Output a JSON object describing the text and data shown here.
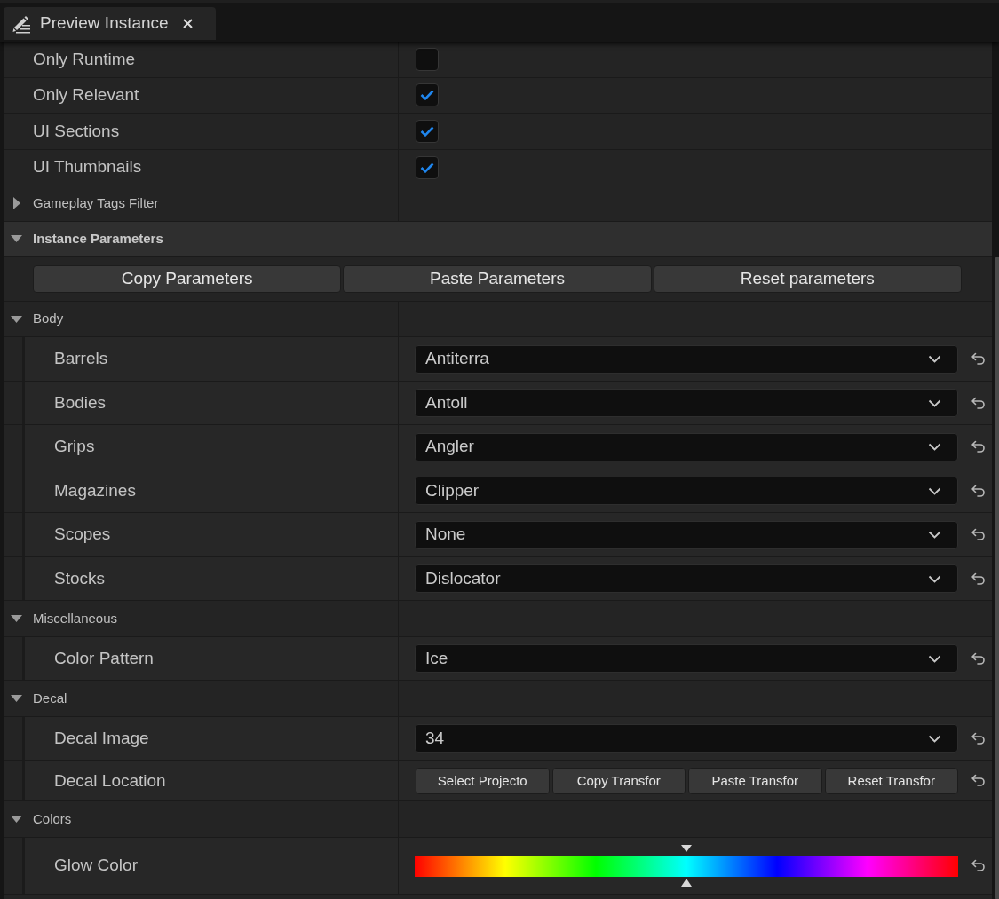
{
  "tab": {
    "title": "Preview Instance"
  },
  "settings": [
    {
      "label": "Only Runtime",
      "checked": false
    },
    {
      "label": "Only Relevant",
      "checked": true
    },
    {
      "label": "UI Sections",
      "checked": true
    },
    {
      "label": "UI Thumbnails",
      "checked": true
    }
  ],
  "sections": [
    {
      "kind": "group",
      "title": "Gameplay Tags Filter",
      "expanded": false
    },
    {
      "kind": "category",
      "title": "Instance Parameters",
      "expanded": true,
      "buttons": [
        "Copy Parameters",
        "Paste Parameters",
        "Reset parameters"
      ]
    },
    {
      "kind": "group",
      "title": "Body",
      "expanded": true,
      "properties": [
        {
          "kind": "dropdown",
          "label": "Barrels",
          "value": "Antiterra"
        },
        {
          "kind": "dropdown",
          "label": "Bodies",
          "value": "Antoll"
        },
        {
          "kind": "dropdown",
          "label": "Grips",
          "value": "Angler"
        },
        {
          "kind": "dropdown",
          "label": "Magazines",
          "value": "Clipper"
        },
        {
          "kind": "dropdown",
          "label": "Scopes",
          "value": "None"
        },
        {
          "kind": "dropdown",
          "label": "Stocks",
          "value": "Dislocator"
        }
      ]
    },
    {
      "kind": "group",
      "title": "Miscellaneous",
      "expanded": true,
      "properties": [
        {
          "kind": "dropdown",
          "label": "Color Pattern",
          "value": "Ice"
        }
      ]
    },
    {
      "kind": "group",
      "title": "Decal",
      "expanded": true,
      "properties": [
        {
          "kind": "dropdown",
          "label": "Decal Image",
          "value": "34"
        },
        {
          "kind": "buttons",
          "label": "Decal Location",
          "buttons": [
            "Select Projecto",
            "Copy Transfor",
            "Paste Transfor",
            "Reset Transfor"
          ]
        }
      ]
    },
    {
      "kind": "group",
      "title": "Colors",
      "expanded": true,
      "properties": [
        {
          "kind": "hue_slider",
          "label": "Glow Color",
          "level": 0.5
        }
      ]
    }
  ]
}
